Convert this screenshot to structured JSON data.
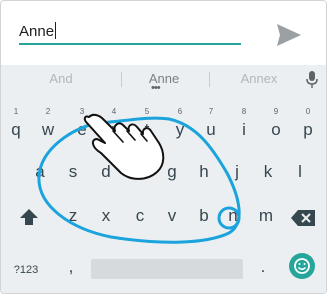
{
  "input": {
    "typed_text": "Anne"
  },
  "suggestions": [
    {
      "text": "And",
      "color": "#b0b6ba"
    },
    {
      "text": "Anne",
      "color": "#7a7f83"
    },
    {
      "text": "Annex",
      "color": "#b0b6ba"
    }
  ],
  "keyboard": {
    "row1": [
      {
        "label": "q",
        "hint": "1"
      },
      {
        "label": "w",
        "hint": "2"
      },
      {
        "label": "e",
        "hint": "3"
      },
      {
        "label": "r",
        "hint": "4"
      },
      {
        "label": "t",
        "hint": "5"
      },
      {
        "label": "y",
        "hint": "6"
      },
      {
        "label": "u",
        "hint": "7"
      },
      {
        "label": "i",
        "hint": "8"
      },
      {
        "label": "o",
        "hint": "9"
      },
      {
        "label": "p",
        "hint": "0"
      }
    ],
    "row2": [
      "a",
      "s",
      "d",
      "f",
      "g",
      "h",
      "j",
      "k",
      "l"
    ],
    "row3": [
      "z",
      "x",
      "c",
      "v",
      "b",
      "n",
      "m"
    ],
    "symbols_key": "?123",
    "comma_key": ",",
    "period_key": "."
  },
  "colors": {
    "accent": "#26a69a",
    "swipe_trail": "#1aa3dc",
    "keyboard_bg": "#eceff1"
  },
  "icons": {
    "send": "send-icon",
    "mic": "microphone-icon",
    "shift": "shift-icon",
    "backspace": "backspace-icon",
    "emoji": "emoji-icon",
    "hand": "hand-pointer-icon"
  }
}
